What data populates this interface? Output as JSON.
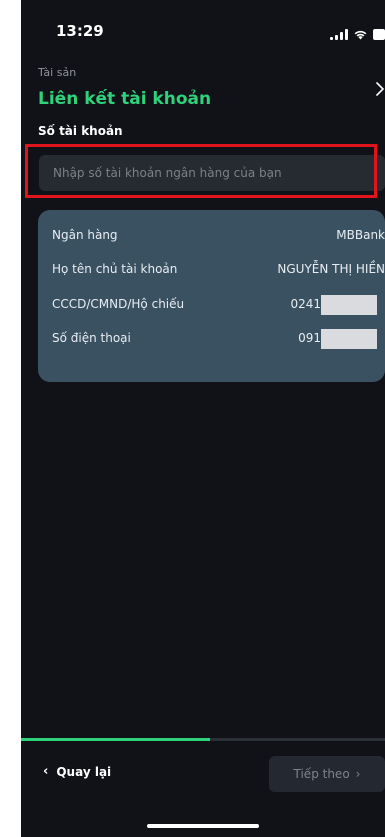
{
  "status_bar": {
    "time": "13:29",
    "icons": [
      "signal-icon",
      "wifi-icon",
      "battery-icon"
    ]
  },
  "header": {
    "breadcrumb": "Tài sản",
    "title": "Liên kết tài khoản",
    "close_icon": "chevron-right-icon"
  },
  "form": {
    "label": "Số tài khoản",
    "placeholder": "Nhập số tài khoản ngân hàng của bạn",
    "value": ""
  },
  "info_card": {
    "rows": [
      {
        "label": "Ngân hàng",
        "value": "MBBank"
      },
      {
        "label": "Họ tên chủ tài khoản",
        "value": "NGUYỄN THỊ HIỀN"
      },
      {
        "label": "CCCD/CMND/Hộ chiếu",
        "value": "0241"
      },
      {
        "label": "Số điện thoại",
        "value": "091"
      }
    ]
  },
  "progress": {
    "fraction": 0.52
  },
  "footer": {
    "back_label": "Quay lại",
    "back_icon": "‹",
    "next_label": "Tiếp theo",
    "next_icon": "›"
  },
  "colors": {
    "accent": "#2ed27b",
    "highlight": "#e1141c",
    "card": "#3a5162",
    "background": "#101217"
  }
}
